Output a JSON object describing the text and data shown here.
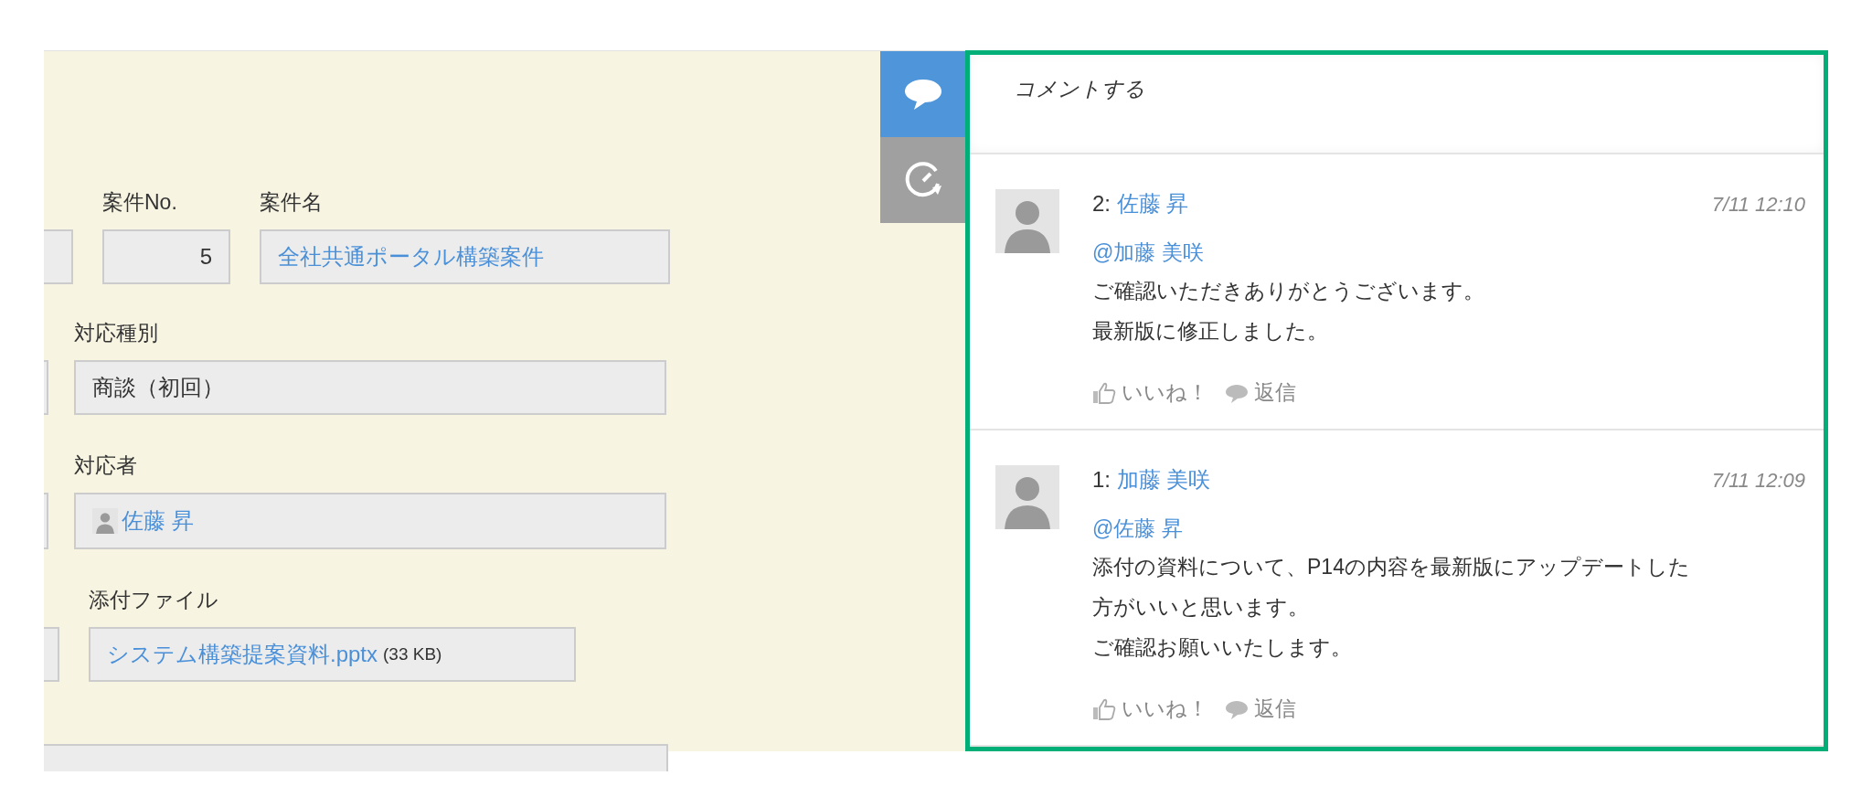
{
  "side_tabs": [
    {
      "kind": "comments",
      "selected": true
    },
    {
      "kind": "history",
      "selected": false
    }
  ],
  "form": {
    "case_no": {
      "label": "案件No.",
      "value": "5"
    },
    "case_name": {
      "label": "案件名",
      "value": "全社共通ポータル構築案件"
    },
    "type": {
      "label": "対応種別",
      "value": "商談（初回）"
    },
    "assignee": {
      "label": "対応者",
      "value": "佐藤 昇"
    },
    "attachment": {
      "label": "添付ファイル",
      "file": "システム構築提案資料.pptx",
      "size": "(33 KB)"
    }
  },
  "comment_box": {
    "placeholder": "コメントする"
  },
  "comments": [
    {
      "number": "2:",
      "author": "佐藤 昇",
      "time": "7/11 12:10",
      "mention": "@加藤 美咲",
      "body_lines": [
        "ご確認いただきありがとうございます。",
        "最新版に修正しました。"
      ],
      "like": "いいね！",
      "reply": "返信"
    },
    {
      "number": "1:",
      "author": "加藤 美咲",
      "time": "7/11 12:09",
      "mention": "@佐藤 昇",
      "body_lines": [
        "添付の資料について、P14の内容を最新版にアップデートした",
        "方がいいと思います。",
        "ご確認お願いいたします。"
      ],
      "like": "いいね！",
      "reply": "返信"
    }
  ]
}
